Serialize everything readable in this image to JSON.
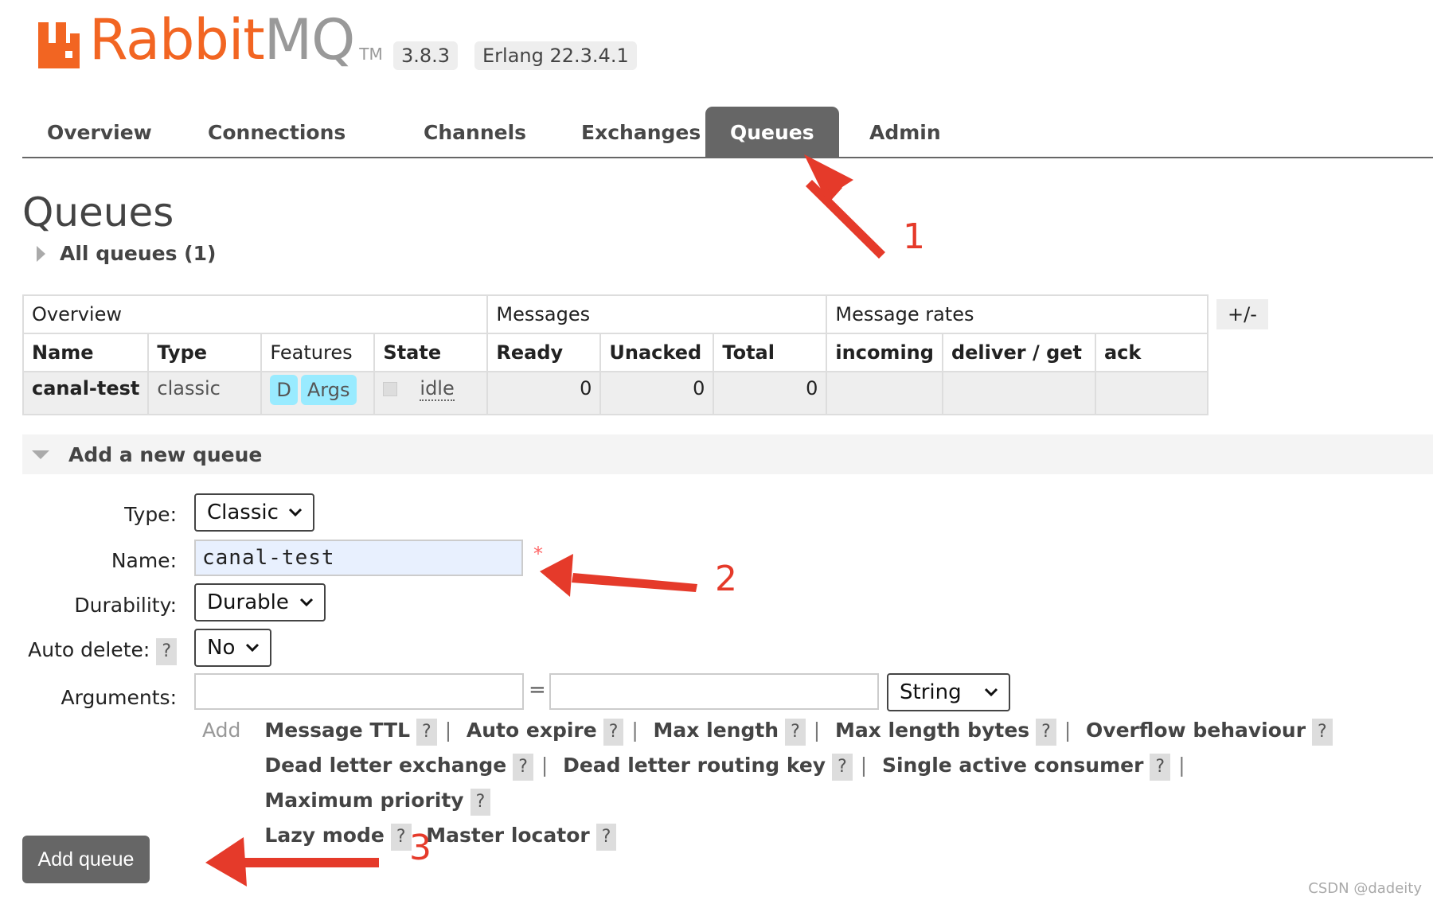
{
  "header": {
    "brand_rabbit": "Rabbit",
    "brand_mq": "MQ",
    "brand_tm": "TM",
    "version": "3.8.3",
    "erlang": "Erlang 22.3.4.1"
  },
  "nav": {
    "tabs": [
      "Overview",
      "Connections",
      "Channels",
      "Exchanges",
      "Queues",
      "Admin"
    ],
    "active": "Queues"
  },
  "page": {
    "title": "Queues",
    "all_queues": "All queues (1)"
  },
  "table": {
    "groups": [
      "Overview",
      "Messages",
      "Message rates"
    ],
    "plus_minus": "+/-",
    "columns": [
      "Name",
      "Type",
      "Features",
      "State",
      "Ready",
      "Unacked",
      "Total",
      "incoming",
      "deliver / get",
      "ack"
    ],
    "rows": [
      {
        "name": "canal-test",
        "type": "classic",
        "feature_d": "D",
        "feature_args": "Args",
        "state": "idle",
        "ready": "0",
        "unacked": "0",
        "total": "0"
      }
    ]
  },
  "add_queue": {
    "heading": "Add a new queue",
    "type_label": "Type:",
    "type_value": "Classic",
    "name_label": "Name:",
    "name_value": "canal-test",
    "required_mark": "*",
    "durability_label": "Durability:",
    "durability_value": "Durable",
    "auto_delete_label": "Auto delete:",
    "auto_delete_value": "No",
    "help": "?",
    "arguments_label": "Arguments:",
    "equals": "=",
    "arg_type_value": "String",
    "add_link": "Add",
    "shortcuts": [
      "Message TTL",
      "Auto expire",
      "Max length",
      "Max length bytes",
      "Overflow behaviour",
      "Dead letter exchange",
      "Dead letter routing key",
      "Single active consumer",
      "Maximum priority",
      "Lazy mode",
      "Master locator"
    ],
    "separator": "|",
    "submit_label": "Add queue"
  },
  "annotations": {
    "one": "1",
    "two": "2",
    "three": "3"
  },
  "watermark": "CSDN @dadeity",
  "colors": {
    "brand_orange": "#f26522",
    "active_tab": "#666666",
    "feature_pill": "#99ebff",
    "annotation_red": "#e53a2a"
  }
}
